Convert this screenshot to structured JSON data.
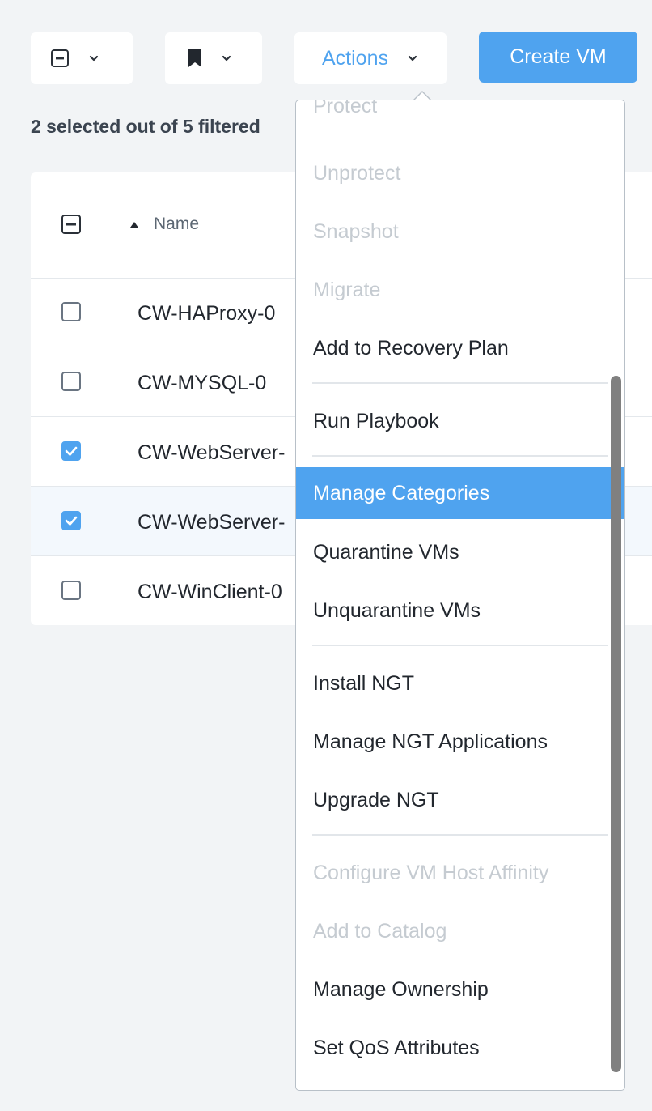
{
  "toolbar": {
    "select_icon": "minus-square-icon",
    "bookmark_icon": "bookmark-icon",
    "actions_label": "Actions",
    "create_label": "Create VM"
  },
  "selection": {
    "text": "2 selected out of 5 filtered"
  },
  "table": {
    "header_name": "Name",
    "sort_icon": "sort-ascending-icon",
    "rows": [
      {
        "name": "CW-HAProxy-0",
        "checked": false
      },
      {
        "name": "CW-MYSQL-0",
        "checked": false
      },
      {
        "name": "CW-WebServer-",
        "checked": true
      },
      {
        "name": "CW-WebServer-",
        "checked": true
      },
      {
        "name": "CW-WinClient-0",
        "checked": false
      }
    ]
  },
  "menu": {
    "items": [
      {
        "label": "Protect",
        "disabled": true
      },
      {
        "label": "Unprotect",
        "disabled": true
      },
      {
        "label": "Snapshot",
        "disabled": true
      },
      {
        "label": "Migrate",
        "disabled": true
      },
      {
        "label": "Add to Recovery Plan",
        "disabled": false
      },
      {
        "label": "Run Playbook",
        "disabled": false
      },
      {
        "label": "Manage Categories",
        "disabled": false,
        "active": true
      },
      {
        "label": "Quarantine VMs",
        "disabled": false
      },
      {
        "label": "Unquarantine VMs",
        "disabled": false
      },
      {
        "label": "Install NGT",
        "disabled": false
      },
      {
        "label": "Manage NGT Applications",
        "disabled": false
      },
      {
        "label": "Upgrade NGT",
        "disabled": false
      },
      {
        "label": "Configure VM Host Affinity",
        "disabled": true
      },
      {
        "label": "Add to Catalog",
        "disabled": true
      },
      {
        "label": "Manage Ownership",
        "disabled": false
      },
      {
        "label": "Set QoS Attributes",
        "disabled": false
      }
    ]
  },
  "colors": {
    "accent": "#4fa3ef",
    "background": "#f2f4f6",
    "disabled_text": "#c5cbd1",
    "scrollbar": "#808080"
  }
}
